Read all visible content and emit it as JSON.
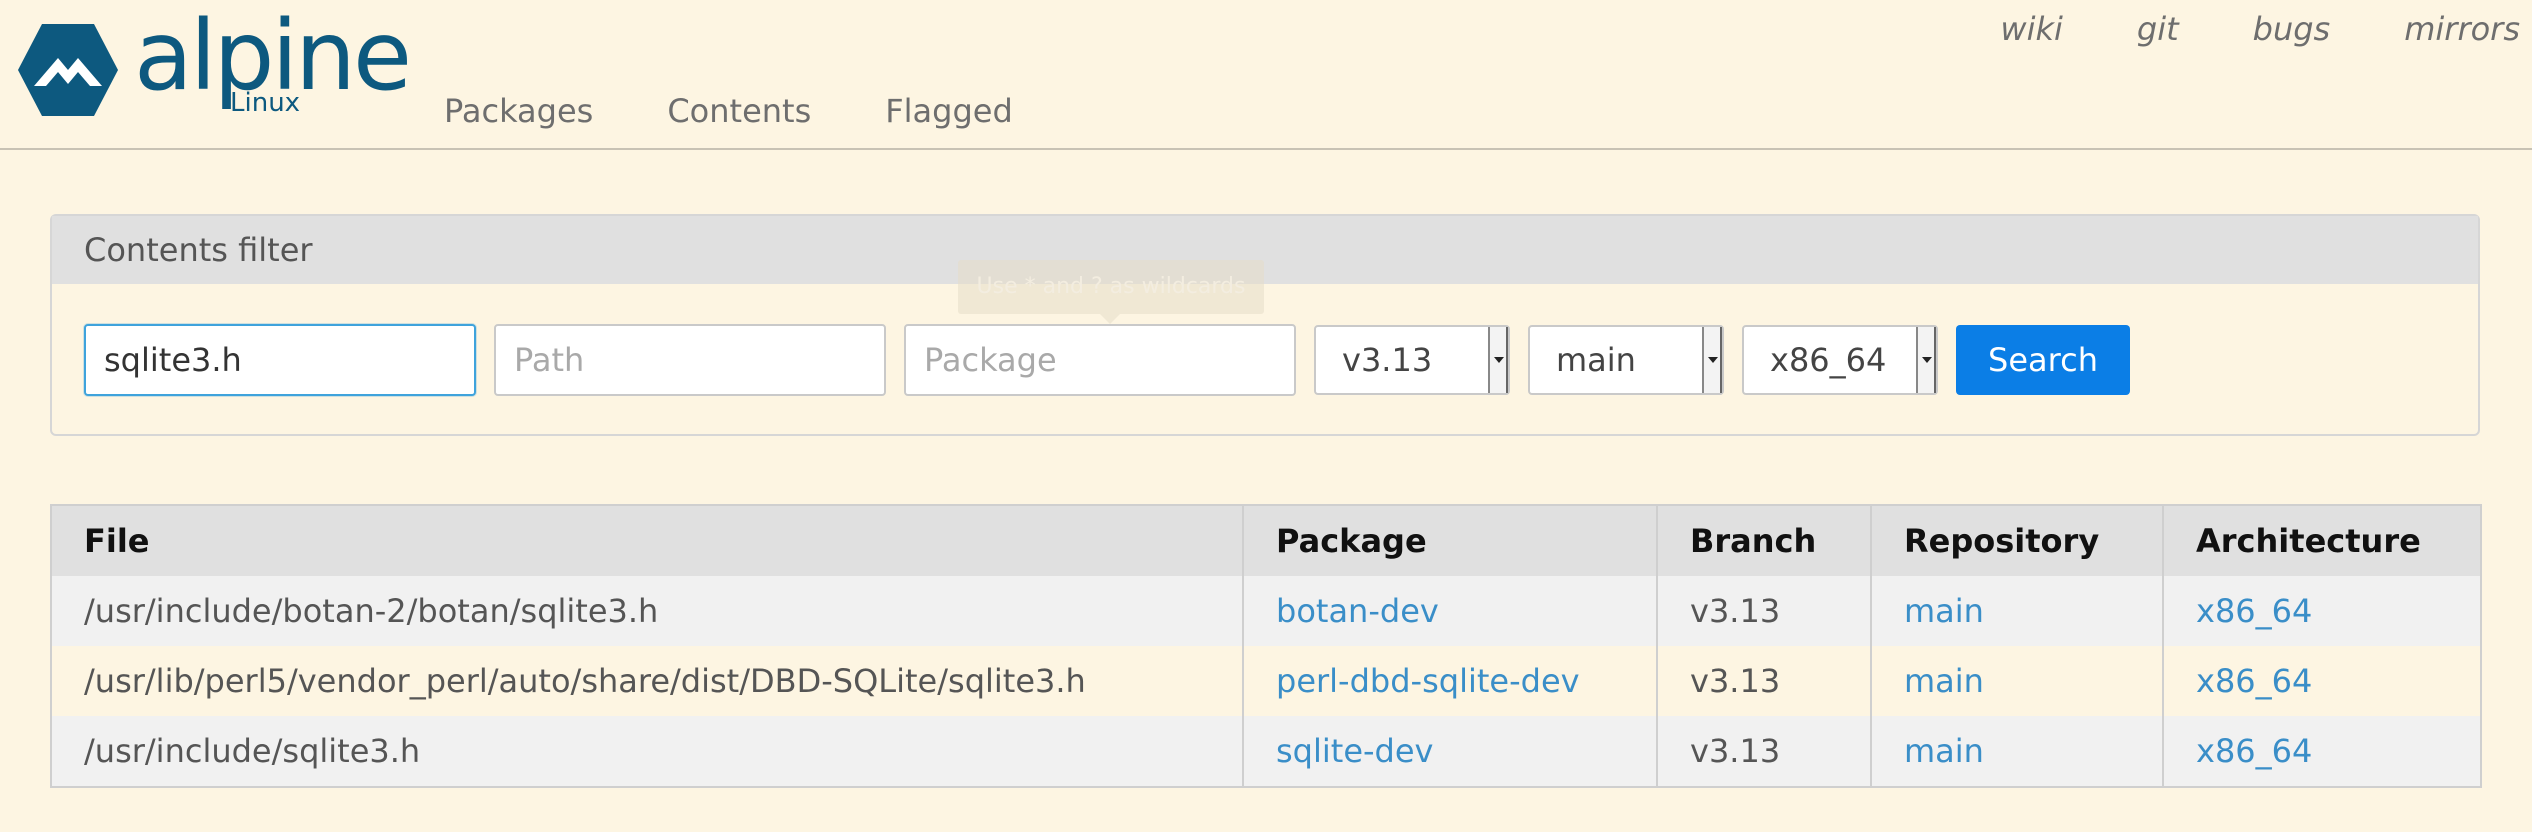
{
  "header": {
    "logo_word": "alpine",
    "logo_sub": "Linux",
    "nav": [
      "Packages",
      "Contents",
      "Flagged"
    ],
    "top_links": [
      "wiki",
      "git",
      "bugs",
      "mirrors"
    ]
  },
  "filter": {
    "heading": "Contents filter",
    "file_value": "sqlite3.h",
    "path_placeholder": "Path",
    "package_placeholder": "Package",
    "tooltip": "Use * and ? as wildcards",
    "branch": "v3.13",
    "repo": "main",
    "arch": "x86_64",
    "search_label": "Search"
  },
  "table": {
    "headers": [
      "File",
      "Package",
      "Branch",
      "Repository",
      "Architecture"
    ],
    "rows": [
      {
        "file": "/usr/include/botan-2/botan/sqlite3.h",
        "package": "botan-dev",
        "branch": "v3.13",
        "repo": "main",
        "arch": "x86_64"
      },
      {
        "file": "/usr/lib/perl5/vendor_perl/auto/share/dist/DBD-SQLite/sqlite3.h",
        "package": "perl-dbd-sqlite-dev",
        "branch": "v3.13",
        "repo": "main",
        "arch": "x86_64"
      },
      {
        "file": "/usr/include/sqlite3.h",
        "package": "sqlite-dev",
        "branch": "v3.13",
        "repo": "main",
        "arch": "x86_64"
      }
    ]
  },
  "colors": {
    "background": "#fdf5e2",
    "brand": "#0d597f",
    "link": "#3a8ec8",
    "button": "#0b7ee6"
  }
}
